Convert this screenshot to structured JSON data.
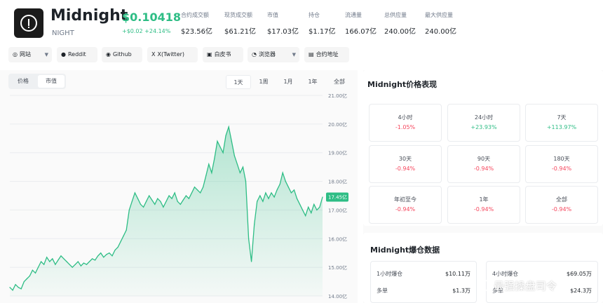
{
  "header": {
    "name": "Midnight",
    "symbol": "NIGHT",
    "price": "$0.10418",
    "change": "+$0.02  +24.14%",
    "stats": [
      {
        "label": "合约成交额",
        "value": "$23.56亿"
      },
      {
        "label": "现货成交额",
        "value": "$61.21亿"
      },
      {
        "label": "市值",
        "value": "$17.03亿"
      },
      {
        "label": "持仓",
        "value": "$1.17亿"
      },
      {
        "label": "流通量",
        "value": "166.07亿"
      },
      {
        "label": "总供应量",
        "value": "240.00亿"
      },
      {
        "label": "最大供应量",
        "value": "240.00亿"
      }
    ]
  },
  "links": [
    {
      "label": "网站",
      "icon": "globe-icon",
      "glyph": "◎",
      "dropdown": true
    },
    {
      "label": "Reddit",
      "icon": "reddit-icon",
      "glyph": "●",
      "dropdown": false
    },
    {
      "label": "Github",
      "icon": "github-icon",
      "glyph": "◉",
      "dropdown": false
    },
    {
      "label": "X(Twitter)",
      "icon": "x-icon",
      "glyph": "X",
      "dropdown": false
    },
    {
      "label": "白皮书",
      "icon": "document-icon",
      "glyph": "▣",
      "dropdown": false
    },
    {
      "label": "浏览器",
      "icon": "explorer-icon",
      "glyph": "◔",
      "dropdown": true
    },
    {
      "label": "合约地址",
      "icon": "contract-icon",
      "glyph": "▤",
      "dropdown": false
    }
  ],
  "chart_tabs": [
    "价格",
    "市值"
  ],
  "active_chart_tab": "市值",
  "ranges": [
    "1天",
    "1周",
    "1月",
    "1年",
    "全部"
  ],
  "active_range": "1天",
  "chart_data": {
    "type": "area",
    "title": "",
    "xlabel": "",
    "ylabel": "",
    "y_tick_labels": [
      "21.00亿",
      "20.00亿",
      "19.00亿",
      "18.00亿",
      "17.00亿",
      "16.00亿",
      "15.00亿",
      "14.00亿"
    ],
    "ylim": [
      14.0,
      21.0
    ],
    "y_unit": "亿",
    "current_value_label": "17.45亿",
    "current_value": 17.45,
    "grid": true,
    "color": "#2ebd85",
    "series": [
      {
        "values": [
          14.3,
          14.2,
          14.4,
          14.3,
          14.25,
          14.5,
          14.6,
          14.7,
          14.9,
          14.8,
          15.0,
          15.2,
          15.1,
          15.35,
          15.2,
          15.3,
          15.1,
          15.25,
          15.4,
          15.3,
          15.2,
          15.1,
          15.0,
          15.1,
          15.2,
          15.05,
          15.15,
          15.1,
          15.2,
          15.3,
          15.25,
          15.4,
          15.5,
          15.35,
          15.45,
          15.5,
          15.4,
          15.6,
          15.7,
          15.9,
          16.1,
          16.3,
          17.0,
          17.3,
          17.6,
          17.4,
          17.2,
          17.1,
          17.3,
          17.5,
          17.35,
          17.2,
          17.4,
          17.3,
          17.1,
          17.3,
          17.5,
          17.4,
          17.6,
          17.3,
          17.2,
          17.35,
          17.5,
          17.4,
          17.6,
          17.8,
          17.7,
          17.6,
          17.8,
          18.2,
          18.6,
          18.3,
          18.8,
          19.4,
          19.2,
          19.0,
          19.6,
          19.9,
          19.4,
          18.9,
          18.6,
          18.3,
          18.5,
          18.0,
          16.0,
          15.2,
          16.5,
          17.3,
          17.5,
          17.3,
          17.6,
          17.4,
          17.6,
          17.45,
          17.7,
          17.9,
          18.3,
          18.0,
          17.8,
          17.6,
          17.7,
          17.4,
          17.2,
          17.0,
          16.8,
          17.1,
          16.9,
          17.2,
          17.0,
          17.1,
          17.45
        ]
      }
    ]
  },
  "performance": {
    "title": "Midnight价格表现",
    "cells": [
      {
        "label": "4小时",
        "value": "-1.05%",
        "dir": "neg"
      },
      {
        "label": "24小时",
        "value": "+23.93%",
        "dir": "pos"
      },
      {
        "label": "7天",
        "value": "+113.97%",
        "dir": "pos"
      },
      {
        "label": "30天",
        "value": "-0.94%",
        "dir": "neg"
      },
      {
        "label": "90天",
        "value": "-0.94%",
        "dir": "neg"
      },
      {
        "label": "180天",
        "value": "-0.94%",
        "dir": "neg"
      },
      {
        "label": "年初至今",
        "value": "-0.94%",
        "dir": "neg"
      },
      {
        "label": "1年",
        "value": "-0.94%",
        "dir": "neg"
      },
      {
        "label": "全部",
        "value": "-0.94%",
        "dir": "neg"
      }
    ]
  },
  "liquidation": {
    "title": "Midnight爆仓数据",
    "left": {
      "label": "1小时爆仓",
      "value": "$10.11万",
      "sub_label": "多单",
      "sub_value": "$1.3万"
    },
    "right": {
      "label": "4小时爆仓",
      "value": "$69.05万",
      "sub_label": "多单",
      "sub_value": "$24.3万"
    }
  },
  "watermark": "最强操盘司令",
  "colors": {
    "up": "#2ebd85",
    "down": "#f6465d",
    "text": "#1e2329",
    "muted": "#707a8a"
  }
}
